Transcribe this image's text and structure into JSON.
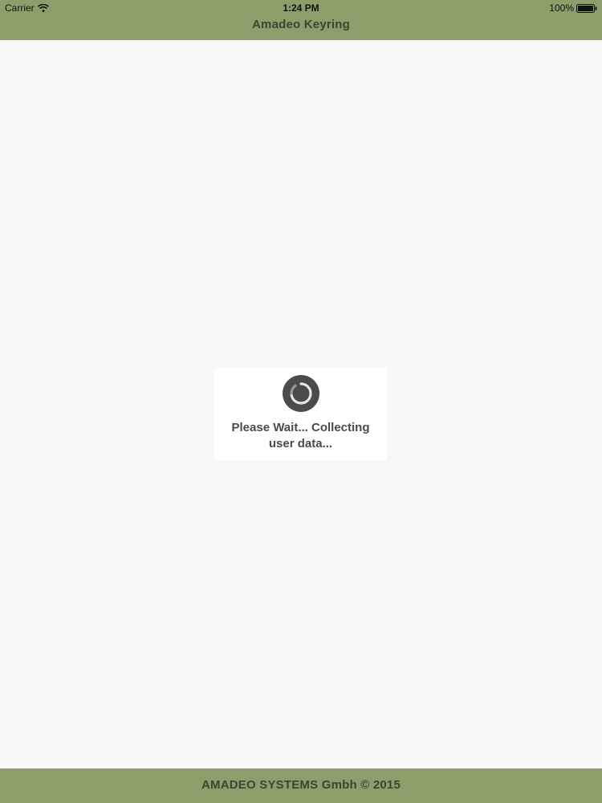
{
  "status_bar": {
    "carrier": "Carrier",
    "time": "1:24 PM",
    "battery": "100%",
    "wifi_icon": "wifi-icon",
    "battery_icon": "battery-icon"
  },
  "nav": {
    "title": "Amadeo Keyring"
  },
  "loading": {
    "spinner_icon": "spinner-icon",
    "line1": "Please Wait... Collecting",
    "line2": "user data..."
  },
  "footer": {
    "text": "AMADEO SYSTEMS Gmbh © 2015"
  },
  "colors": {
    "bar_background": "#8c9f6b",
    "page_background": "#f8f8f9",
    "title_text": "#3c4334",
    "loading_text": "#4a4a4a"
  }
}
